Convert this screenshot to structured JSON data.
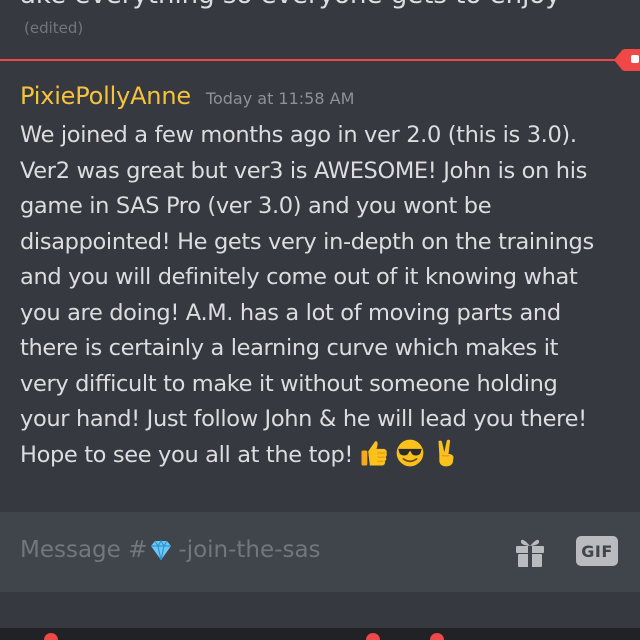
{
  "previous_message": {
    "cut_text": "ake everything so everyone gets to enjoy",
    "edited_tag": "(edited)"
  },
  "message": {
    "username": "PixiePollyAnne",
    "timestamp": "Today at 11:58 AM",
    "body_lines": [
      "We joined a few months ago in ver 2.0 (this is 3.0).",
      "Ver2 was great but ver3 is AWESOME! John is on his",
      "game in SAS Pro (ver 3.0) and you wont be",
      "disappointed! He gets very in-depth on the trainings",
      "and you will definitely come out of it  knowing what",
      "you are doing! A.M. has a lot of moving parts and",
      "there is certainly a learning curve which makes it",
      "very difficult to make it without someone holding",
      "your hand! Just follow John & he will lead you there!",
      "Hope to see you all at the top!"
    ],
    "emojis": [
      "thumbs-up-icon",
      "sunglasses-face-icon",
      "victory-hand-icon"
    ]
  },
  "composer": {
    "placeholder_prefix": "Message #",
    "channel_icon": "gem-icon",
    "placeholder_channel": " -join-the-sas",
    "gif_label": "GIF"
  },
  "colors": {
    "background": "#36393f",
    "username": "#f7c23c",
    "new_divider": "#f04747",
    "composer_bg": "#40444b"
  }
}
